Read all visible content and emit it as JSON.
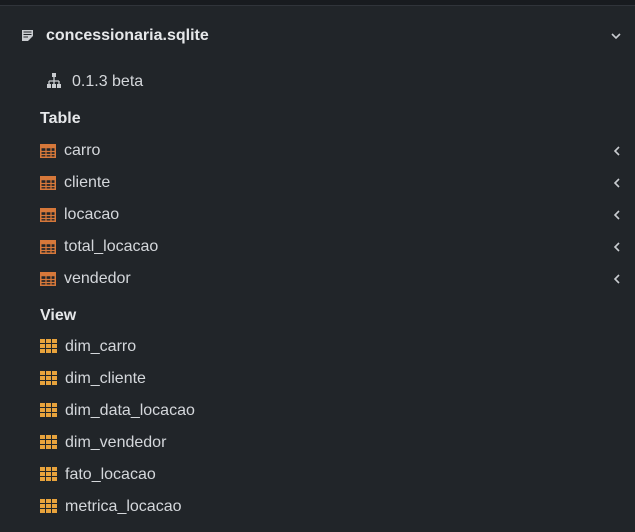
{
  "database": {
    "name": "concessionaria.sqlite",
    "version": "0.1.3 beta"
  },
  "sections": {
    "table_title": "Table",
    "view_title": "View"
  },
  "tables": [
    {
      "label": "carro"
    },
    {
      "label": "cliente"
    },
    {
      "label": "locacao"
    },
    {
      "label": "total_locacao"
    },
    {
      "label": "vendedor"
    }
  ],
  "views": [
    {
      "label": "dim_carro"
    },
    {
      "label": "dim_cliente"
    },
    {
      "label": "dim_data_locacao"
    },
    {
      "label": "dim_vendedor"
    },
    {
      "label": "fato_locacao"
    },
    {
      "label": "metrica_locacao"
    }
  ],
  "colors": {
    "table_icon": "#d6783a",
    "view_icon": "#e8a33c",
    "background": "#212529"
  },
  "icons": {
    "database": "database-file-icon",
    "version": "hierarchy-icon",
    "table": "table-icon",
    "view": "view-grid-icon",
    "expand": "chevron-left-icon",
    "collapse": "chevron-down-icon"
  }
}
